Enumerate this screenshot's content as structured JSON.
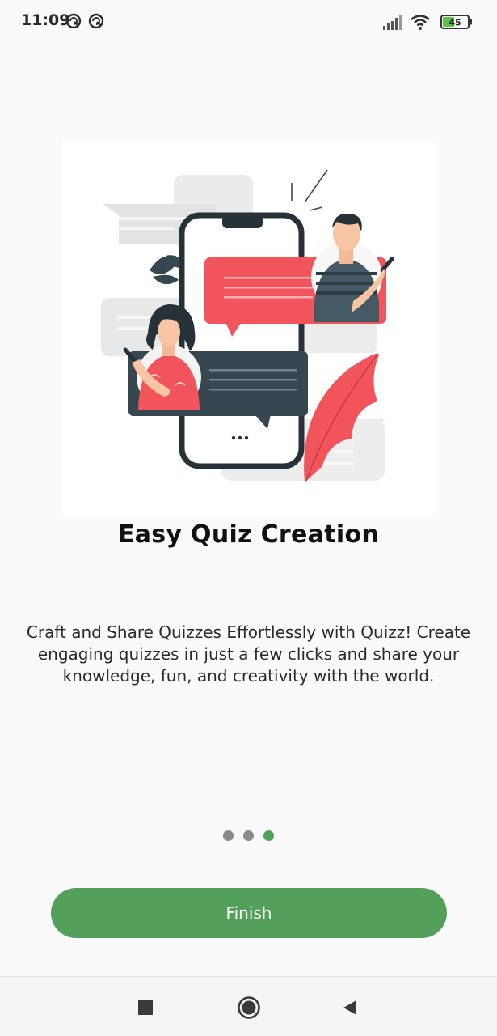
{
  "status_bar": {
    "time": "11:09",
    "battery_level": "45",
    "icons": [
      "notification-icon",
      "notification-icon",
      "cellular-signal-icon",
      "wifi-icon",
      "battery-icon"
    ]
  },
  "onboarding": {
    "illustration": "chat-phone-illustration",
    "title": "Easy Quiz Creation",
    "description": "Craft and Share Quizzes Effortlessly with Quizz! Create engaging quizzes in just a few clicks and share your knowledge, fun, and creativity with the world.",
    "page_indicator": {
      "total": 3,
      "current": 3
    },
    "finish_label": "Finish"
  },
  "navigation_bar": {
    "buttons": [
      "recents-icon",
      "home-icon",
      "back-icon"
    ]
  },
  "colors": {
    "accent": "#52a05a",
    "coral": "#f2545b",
    "dark_slate": "#37474f",
    "inactive_dot": "#8a8a8a"
  }
}
